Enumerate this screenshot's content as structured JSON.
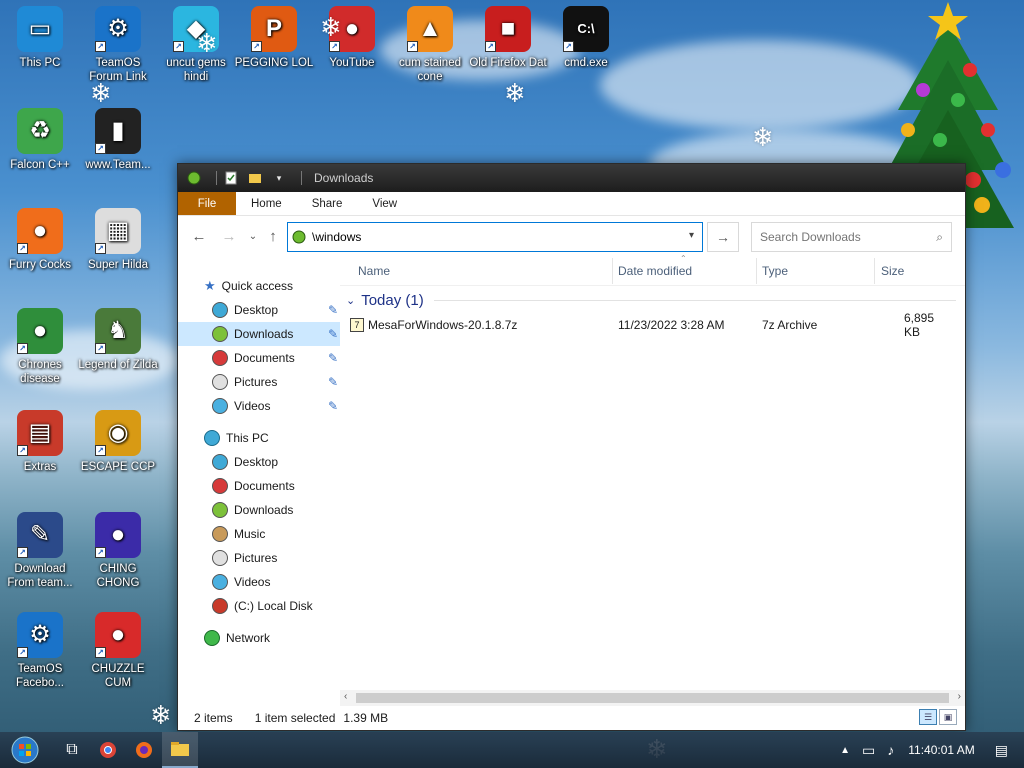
{
  "desktop": {
    "icons": [
      {
        "label": "This PC",
        "color": "#1f8ad6",
        "glyph": "▭"
      },
      {
        "label": "TeamOS Forum Link",
        "color": "#1a73c9",
        "glyph": "⚙"
      },
      {
        "label": "uncut gems hindi",
        "color": "#2bb6e0",
        "glyph": "◆"
      },
      {
        "label": "PEGGING LOL",
        "color": "#e05a12",
        "glyph": "P"
      },
      {
        "label": "YouTube",
        "color": "#d12b2b",
        "glyph": "●"
      },
      {
        "label": "cum stained cone",
        "color": "#f08a1a",
        "glyph": "▲"
      },
      {
        "label": "Old Firefox Dat",
        "color": "#c81e1e",
        "glyph": "■"
      },
      {
        "label": "cmd.exe",
        "color": "#111111",
        "glyph": "C:\\"
      },
      {
        "label": "Falcon C++",
        "color": "#3ea64b",
        "glyph": "♻"
      },
      {
        "label": "www.Team...",
        "color": "#222222",
        "glyph": "▮"
      },
      {
        "label": "Furry Cocks",
        "color": "#f06d1b",
        "glyph": "●"
      },
      {
        "label": "Super Hilda",
        "color": "#dddddd",
        "glyph": "▦"
      },
      {
        "label": "Chrones disease",
        "color": "#2f8e3b",
        "glyph": "●"
      },
      {
        "label": "Legend of Zilda",
        "color": "#4a7a3a",
        "glyph": "♞"
      },
      {
        "label": "Extras",
        "color": "#c83a2a",
        "glyph": "▤"
      },
      {
        "label": "ESCAPE CCP",
        "color": "#d89a14",
        "glyph": "◉"
      },
      {
        "label": "Download From team...",
        "color": "#2b4a8a",
        "glyph": "✎"
      },
      {
        "label": "CHING CHONG",
        "color": "#3b2ba8",
        "glyph": "●"
      },
      {
        "label": "TeamOS Facebo...",
        "color": "#1a73c9",
        "glyph": "⚙"
      },
      {
        "label": "CHUZZLE CUM",
        "color": "#d82a2a",
        "glyph": "●"
      }
    ]
  },
  "window": {
    "title": "Downloads",
    "ribbon_tabs": [
      "File",
      "Home",
      "Share",
      "View"
    ],
    "address_value": "\\windows",
    "search_placeholder": "Search Downloads",
    "columns": [
      "Name",
      "Date modified",
      "Type",
      "Size"
    ],
    "nav": {
      "quick_access": "Quick access",
      "quick_items": [
        "Desktop",
        "Downloads",
        "Documents",
        "Pictures",
        "Videos"
      ],
      "this_pc": "This PC",
      "pc_items": [
        "Desktop",
        "Documents",
        "Downloads",
        "Music",
        "Pictures",
        "Videos",
        "(C:) Local Disk"
      ],
      "network": "Network"
    },
    "group_label": "Today (1)",
    "files": [
      {
        "name": "MesaForWindows-20.1.8.7z",
        "date": "11/23/2022 3:28 AM",
        "type": "7z Archive",
        "size": "6,895 KB"
      }
    ],
    "status": {
      "items": "2 items",
      "selected": "1 item selected",
      "size": "1.39 MB"
    }
  },
  "taskbar": {
    "clock": "11:40:01 AM"
  }
}
